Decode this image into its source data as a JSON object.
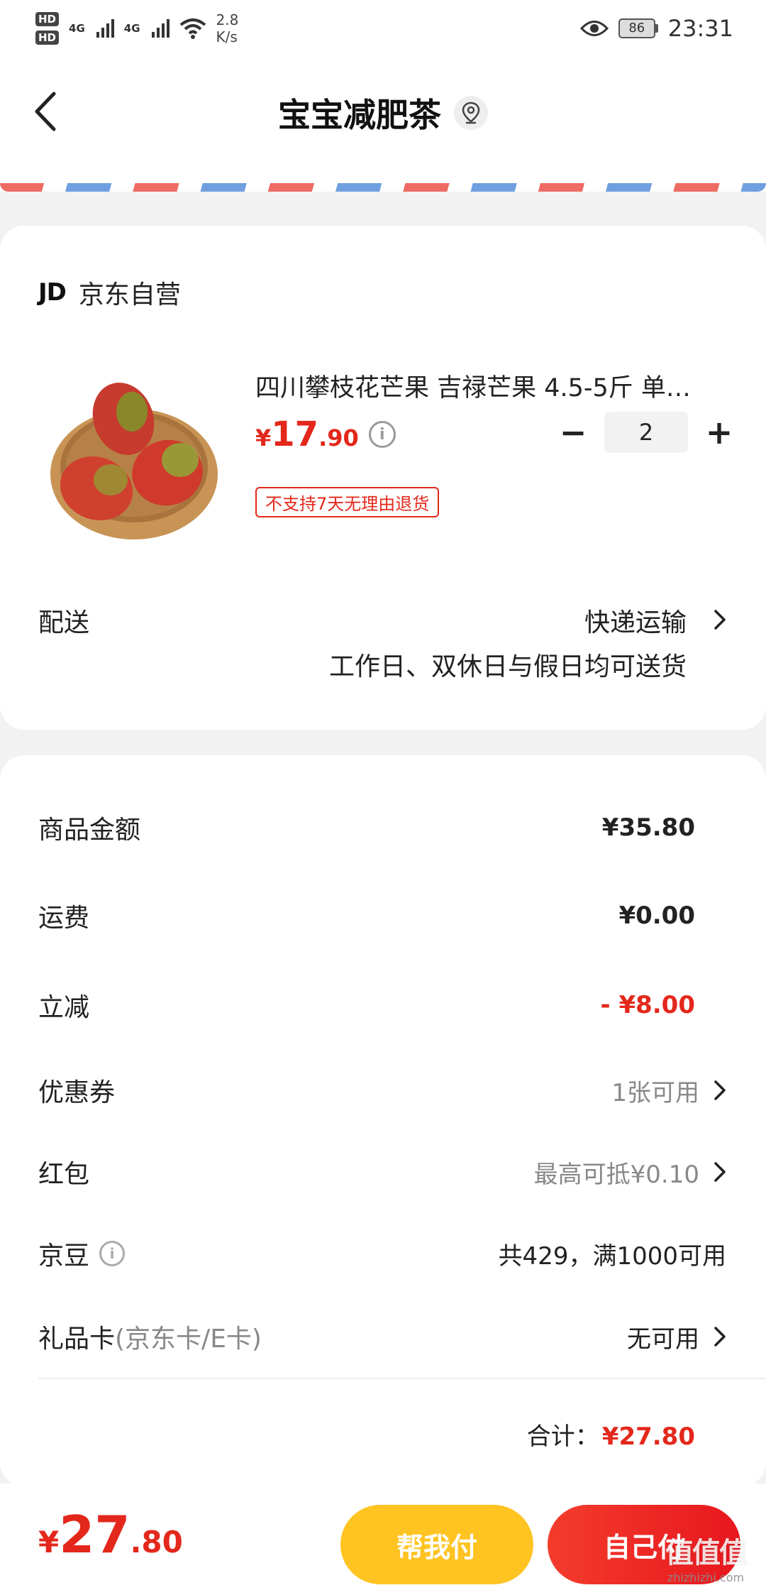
{
  "status_bar": {
    "hd1": "HD",
    "hd2": "HD",
    "net1": "4G",
    "net2": "4G",
    "speed_value": "2.8",
    "speed_unit": "K/s",
    "battery": "86",
    "time": "23:31"
  },
  "header": {
    "title": "宝宝减肥茶"
  },
  "shop": {
    "logo": "JD",
    "name": "京东自营"
  },
  "product": {
    "title": "四川攀枝花芒果 吉禄芒果 4.5-5斤 单…",
    "price_symbol": "¥",
    "price_int": "17",
    "price_dec": ".90",
    "quantity": "2",
    "minus": "−",
    "plus": "+",
    "return_tag": "不支持7天无理由退货"
  },
  "delivery": {
    "label": "配送",
    "method": "快递运输",
    "note": "工作日、双休日与假日均可送货"
  },
  "summary": {
    "goods_label": "商品金额",
    "goods_value": "¥35.80",
    "shipping_label": "运费",
    "shipping_value": "¥0.00",
    "discount_label": "立减",
    "discount_value": "- ¥8.00",
    "coupon_label": "优惠券",
    "coupon_value": "1张可用",
    "redpacket_label": "红包",
    "redpacket_value": "最高可抵¥0.10",
    "jingdou_label": "京豆",
    "jingdou_value": "共429，满1000可用",
    "giftcard_label": "礼品卡",
    "giftcard_sub": "(京东卡/E卡)",
    "giftcard_value": "无可用",
    "total_label": "合计：",
    "total_value": "¥27.80"
  },
  "bottom": {
    "price_symbol": "¥",
    "price_int": "27",
    "price_dec": ".80",
    "help_pay": "帮我付",
    "self_pay": "自己付",
    "watermark_logo": "值值值",
    "watermark_url": "zhizhizhi.com"
  },
  "colors": {
    "accent_red": "#e3281b",
    "help_yellow": "#ffc322"
  }
}
